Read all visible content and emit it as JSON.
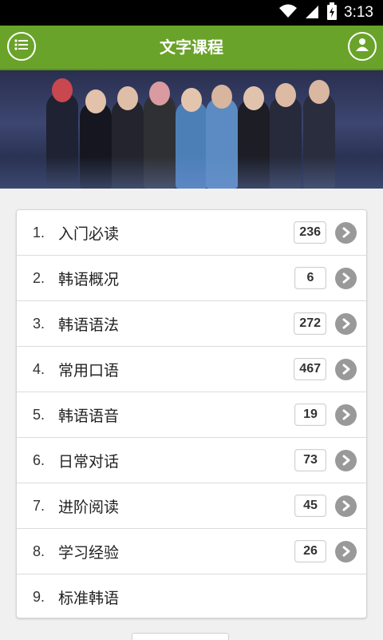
{
  "status": {
    "time": "3:13"
  },
  "header": {
    "title": "文字课程"
  },
  "icons": {
    "menu": "list-icon",
    "user": "user-icon",
    "wifi": "wifi-icon",
    "signal": "signal-icon",
    "battery": "battery-icon"
  },
  "colors": {
    "appbar": "#6aa329",
    "arrow": "#999999"
  },
  "courses": [
    {
      "num": "1.",
      "label": "入门必读",
      "count": "236"
    },
    {
      "num": "2.",
      "label": "韩语概况",
      "count": "6"
    },
    {
      "num": "3.",
      "label": "韩语语法",
      "count": "272"
    },
    {
      "num": "4.",
      "label": "常用口语",
      "count": "467"
    },
    {
      "num": "5.",
      "label": "韩语语音",
      "count": "19"
    },
    {
      "num": "6.",
      "label": "日常对话",
      "count": "73"
    },
    {
      "num": "7.",
      "label": "进阶阅读",
      "count": "45"
    },
    {
      "num": "8.",
      "label": "学习经验",
      "count": "26"
    },
    {
      "num": "9.",
      "label": "标准韩语",
      "count": ""
    }
  ]
}
